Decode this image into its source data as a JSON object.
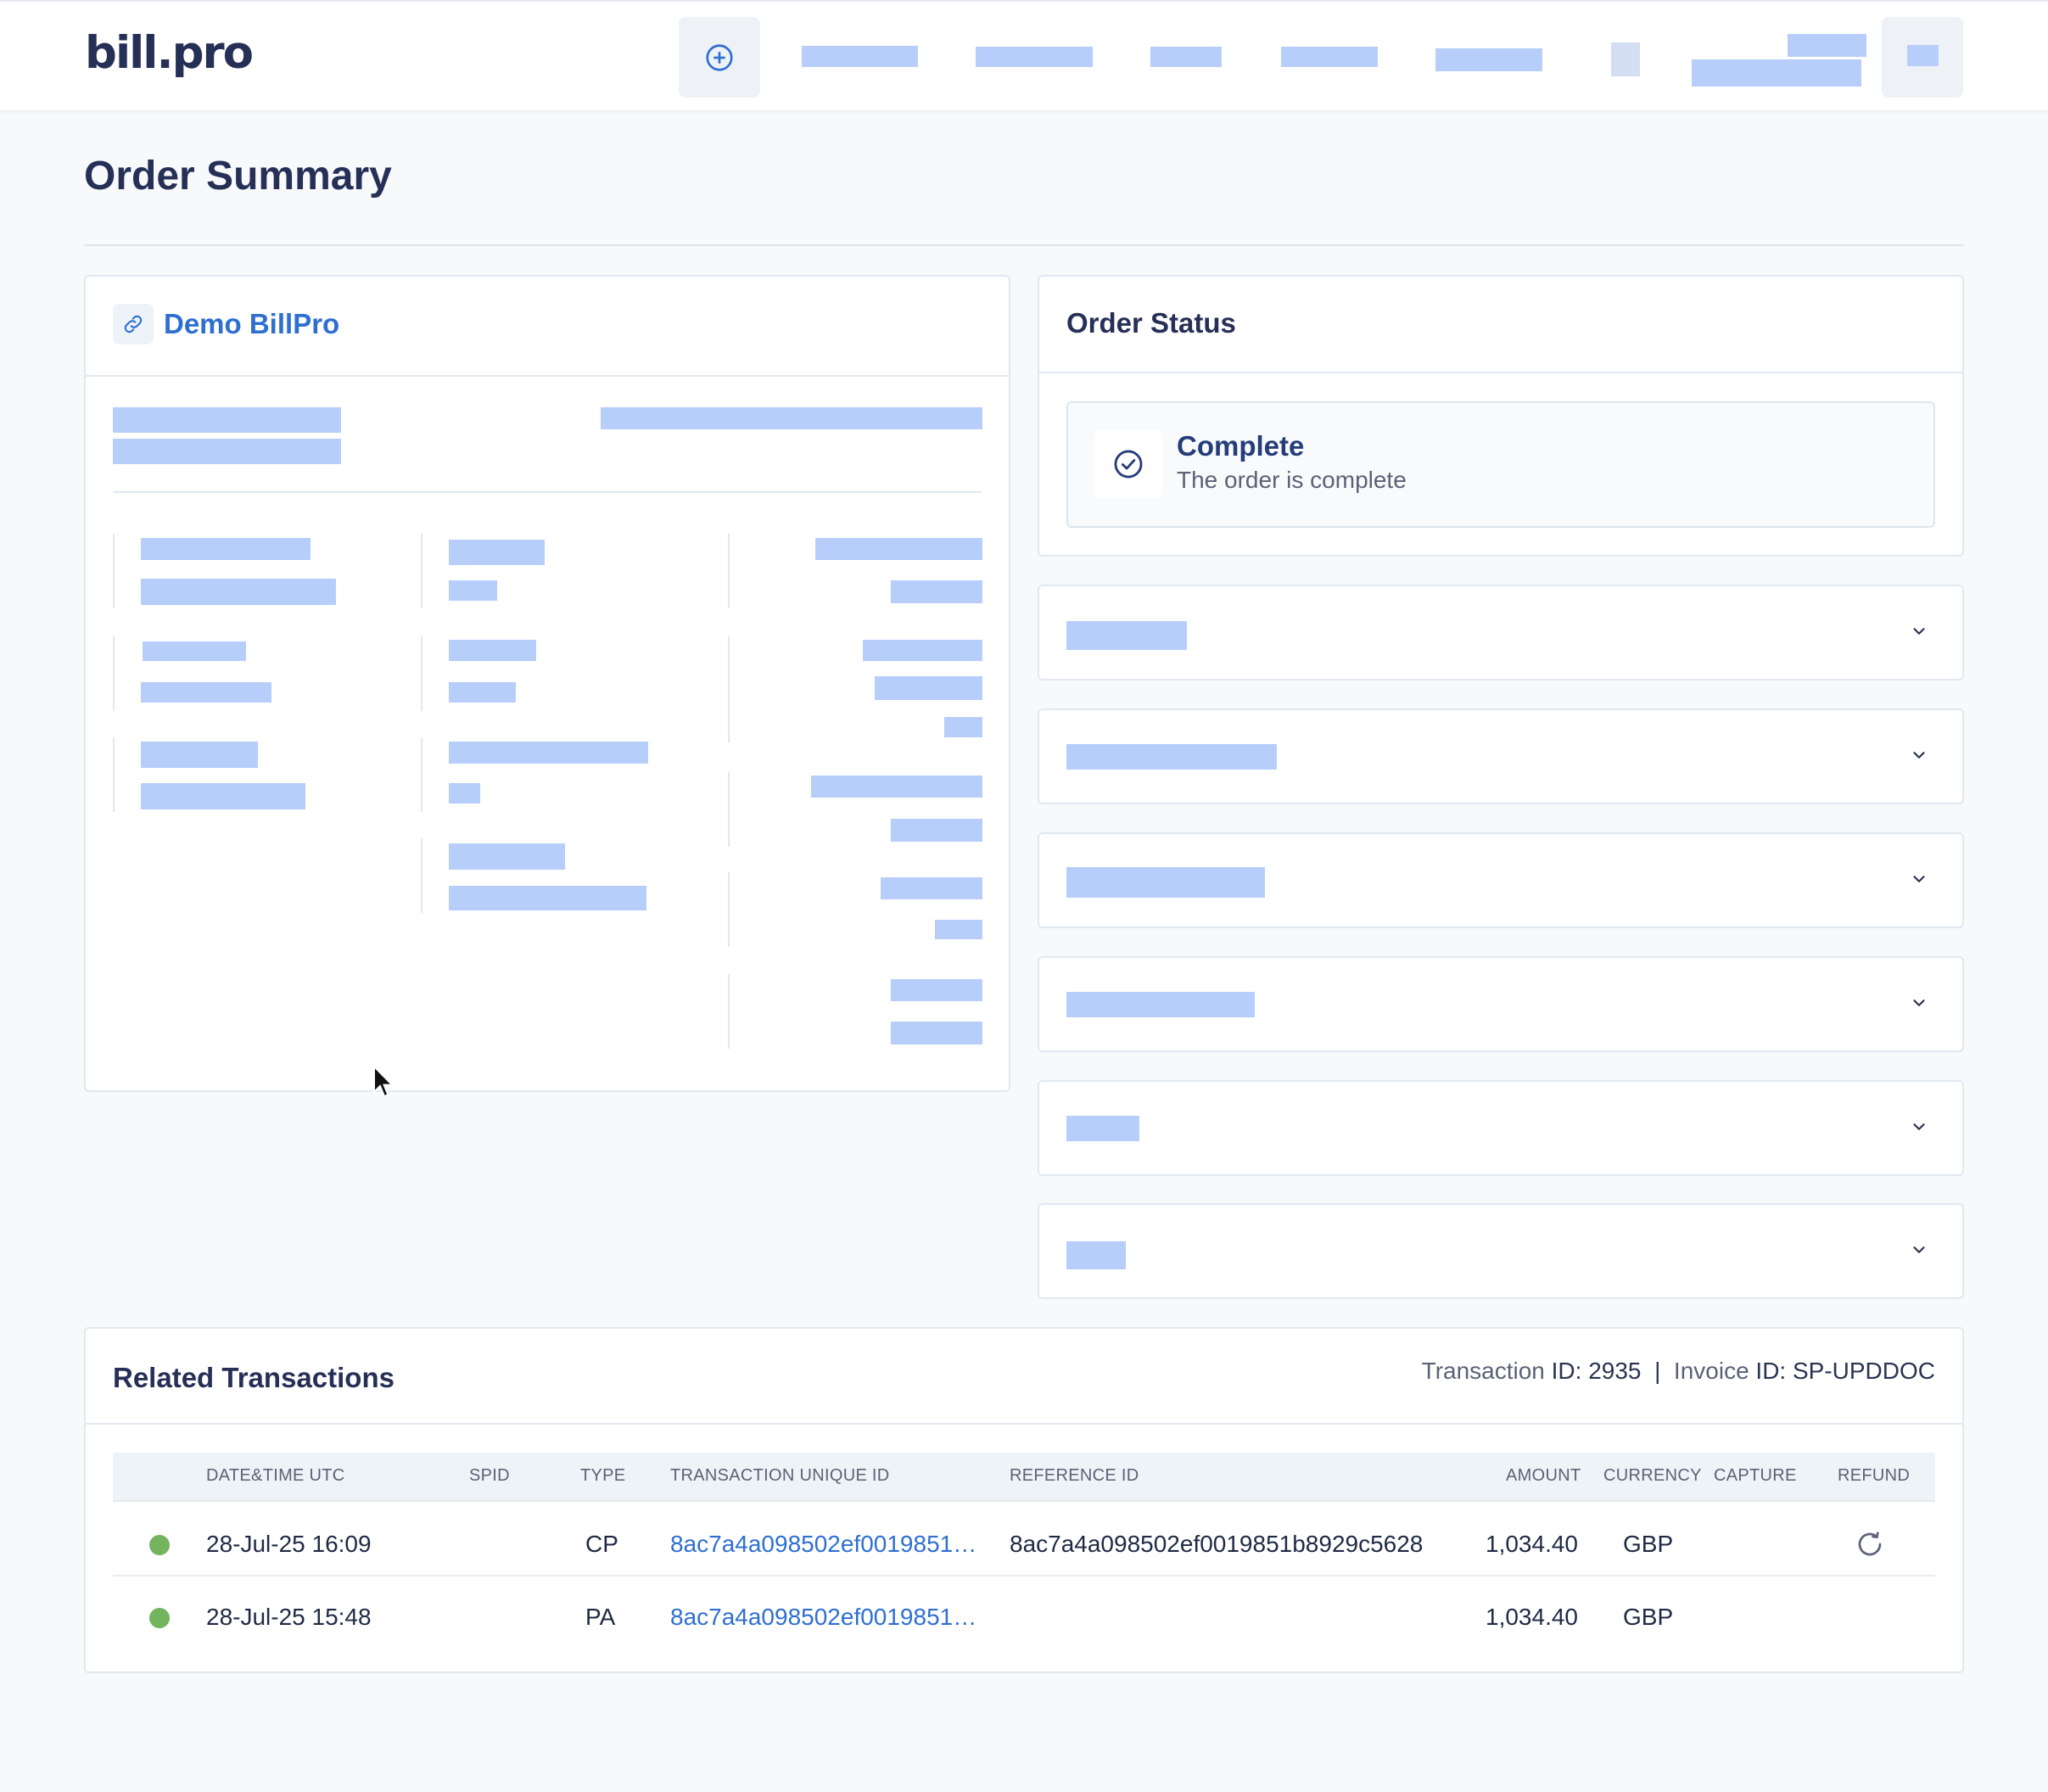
{
  "app": {
    "logo": "bill.pro"
  },
  "page": {
    "title": "Order Summary"
  },
  "merchant": {
    "name": "Demo BillPro"
  },
  "order_status": {
    "title": "Order Status",
    "status": "Complete",
    "description": "The order is complete"
  },
  "transactions": {
    "title": "Related Transactions",
    "transaction_id_label": "Transaction",
    "transaction_id_rest": "ID: 2935",
    "separator": "|",
    "invoice_id_label": "Invoice",
    "invoice_id_rest": "ID: SP-UPDDOC",
    "columns": {
      "datetime": "DATE&TIME UTC",
      "spid": "SPID",
      "type": "TYPE",
      "unique_id": "TRANSACTION UNIQUE ID",
      "reference_id": "REFERENCE ID",
      "amount": "AMOUNT",
      "currency": "CURRENCY",
      "capture": "CAPTURE",
      "refund": "REFUND"
    },
    "rows": [
      {
        "status_color": "#74b45f",
        "datetime": "28-Jul-25 16:09",
        "spid": "",
        "type": "CP",
        "unique_id": "8ac7a4a098502ef0019851…",
        "reference_id": "8ac7a4a098502ef0019851b8929c5628",
        "amount": "1,034.40",
        "currency": "GBP",
        "refund_icon": "refresh-icon"
      },
      {
        "status_color": "#74b45f",
        "datetime": "28-Jul-25 15:48",
        "spid": "",
        "type": "PA",
        "unique_id": "8ac7a4a098502ef0019851…",
        "reference_id": "",
        "amount": "1,034.40",
        "currency": "GBP"
      }
    ]
  },
  "colors": {
    "brand": "#263057",
    "link": "#2e6fd0",
    "placeholder": "#b7cefa",
    "success": "#74b45f",
    "background": "#f7f9fb"
  },
  "icons": [
    "plus-circle-icon",
    "link-icon",
    "check-circle-icon",
    "chevron-down-icon",
    "refresh-icon",
    "mouse-cursor-icon"
  ]
}
